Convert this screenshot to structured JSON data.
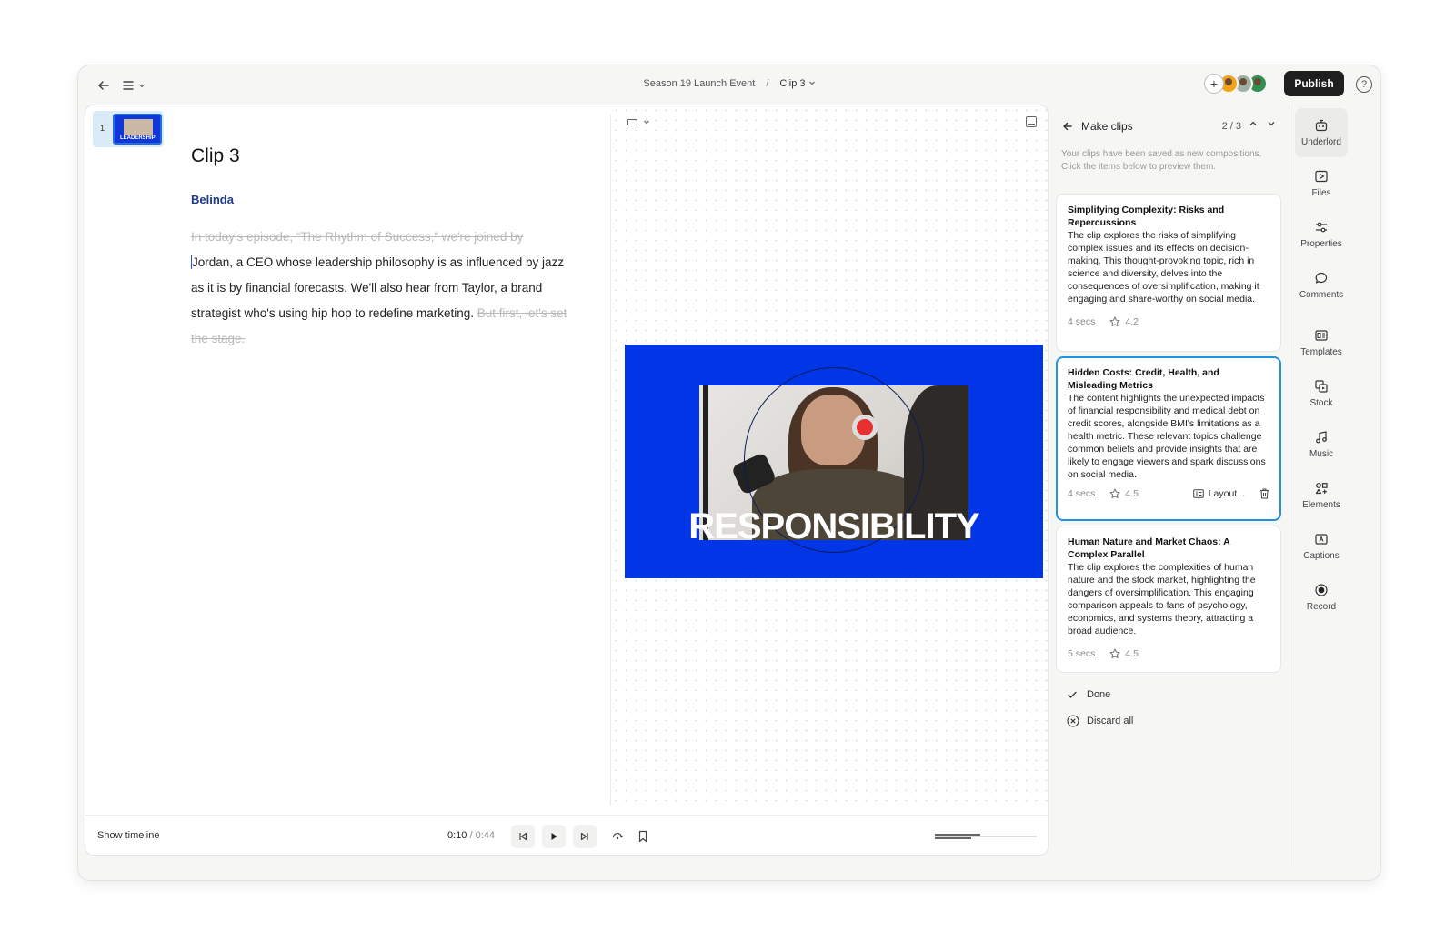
{
  "breadcrumb": {
    "project": "Season 19 Launch Event",
    "separator": "/",
    "clip": "Clip 3"
  },
  "header": {
    "publish_label": "Publish",
    "help_label": "?",
    "add_label": "+"
  },
  "scene": {
    "number": "1",
    "thumb_word": "LEADERSHIP"
  },
  "document": {
    "title": "Clip 3",
    "speaker": "Belinda",
    "struck_intro": "In today's episode, “The Rhythm of Success,” we're joined by",
    "body": "Jordan, a CEO whose leadership philosophy is as influenced by jazz as it is by financial forecasts. We'll also hear from Taylor, a brand strategist who's using hip hop to redefine marketing.",
    "struck_outro": "But first, let's set the stage."
  },
  "preview": {
    "overlay_word": "RESPONSIBILITY"
  },
  "playback": {
    "show_timeline_label": "Show timeline",
    "current_time": "0:10",
    "separator": " / ",
    "total_time": "0:44"
  },
  "clips_panel": {
    "title": "Make clips",
    "counter": "2 / 3",
    "info": "Your clips have been saved as new compositions. Click the items below to preview them.",
    "cards": [
      {
        "title": "Simplifying Complexity: Risks and Repercussions",
        "description": "The clip explores the risks of simplifying complex issues and its effects on decision-making. This thought-provoking topic, rich in science and diversity, delves into the consequences of oversimplification, making it engaging and share-worthy on social media.",
        "duration": "4 secs",
        "rating": "4.2"
      },
      {
        "title": "Hidden Costs: Credit, Health, and Misleading Metrics",
        "description": "The content highlights the unexpected impacts of financial responsibility and medical debt on credit scores, alongside BMI's limitations as a health metric. These relevant topics challenge common beliefs and provide insights that are likely to engage viewers and spark discussions on social media.",
        "duration": "4 secs",
        "rating": "4.5",
        "layout_label": "Layout..."
      },
      {
        "title": "Human Nature and Market Chaos: A Complex Parallel",
        "description": "The clip explores the complexities of human nature and the stock market, highlighting the dangers of oversimplification. This engaging comparison appeals to fans of psychology, economics, and systems theory, attracting a broad audience.",
        "duration": "5 secs",
        "rating": "4.5"
      }
    ],
    "done_label": "Done",
    "discard_label": "Discard all"
  },
  "rail": {
    "items": [
      {
        "label": "Underlord",
        "icon": "robot-icon"
      },
      {
        "label": "Files",
        "icon": "play-folder-icon"
      },
      {
        "label": "Properties",
        "icon": "sliders-icon"
      },
      {
        "label": "Comments",
        "icon": "comment-icon"
      },
      {
        "label": "Templates",
        "icon": "template-icon"
      },
      {
        "label": "Stock",
        "icon": "stock-icon"
      },
      {
        "label": "Music",
        "icon": "music-icon"
      },
      {
        "label": "Elements",
        "icon": "elements-icon"
      },
      {
        "label": "Captions",
        "icon": "captions-icon"
      },
      {
        "label": "Record",
        "icon": "record-icon"
      }
    ]
  },
  "colors": {
    "accent": "#1f92e0",
    "preview_bg": "#0036e6",
    "speaker": "#1d3a8a",
    "publish_bg": "#1f1f1f"
  }
}
